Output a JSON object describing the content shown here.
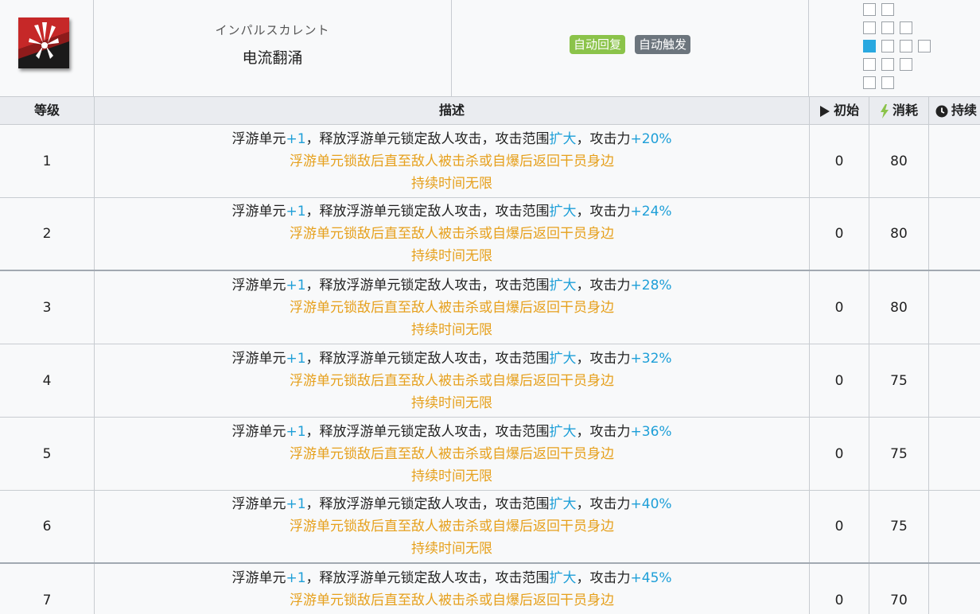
{
  "skill": {
    "name_jp": "インパルスカレント",
    "name_cn": "电流翻涌",
    "tags": [
      {
        "label": "自动回复",
        "color": "#8bc34a"
      },
      {
        "label": "自动触发",
        "color": "#6c757d"
      }
    ],
    "icon": "skill-icon"
  },
  "columns": {
    "level": "等级",
    "desc": "描述",
    "init": "初始",
    "cost": "消耗",
    "duration": "持续"
  },
  "text": {
    "d1_a": "浮游单元",
    "d1_b": "+1",
    "d1_c": "，释放浮游单元锁定敌人攻击，攻击范围",
    "d1_d": "扩大",
    "d1_e": "，攻击力",
    "d2": "浮游单元锁敌后直至敌人被击杀或自爆后返回干员身边",
    "d3": "持续时间无限"
  },
  "rows": [
    {
      "level": "1",
      "atk": "+20%",
      "init": "0",
      "cost": "80"
    },
    {
      "level": "2",
      "atk": "+24%",
      "init": "0",
      "cost": "80"
    },
    {
      "level": "3",
      "atk": "+28%",
      "init": "0",
      "cost": "80"
    },
    {
      "level": "4",
      "atk": "+32%",
      "init": "0",
      "cost": "75"
    },
    {
      "level": "5",
      "atk": "+36%",
      "init": "0",
      "cost": "75"
    },
    {
      "level": "6",
      "atk": "+40%",
      "init": "0",
      "cost": "75"
    },
    {
      "level": "7",
      "atk": "+45%",
      "init": "0",
      "cost": "70"
    }
  ],
  "colors": {
    "accent_blue": "#1e9fd8",
    "accent_orange": "#e6a01c",
    "init_icon": "#222222",
    "cost_icon": "#8bc34a"
  }
}
